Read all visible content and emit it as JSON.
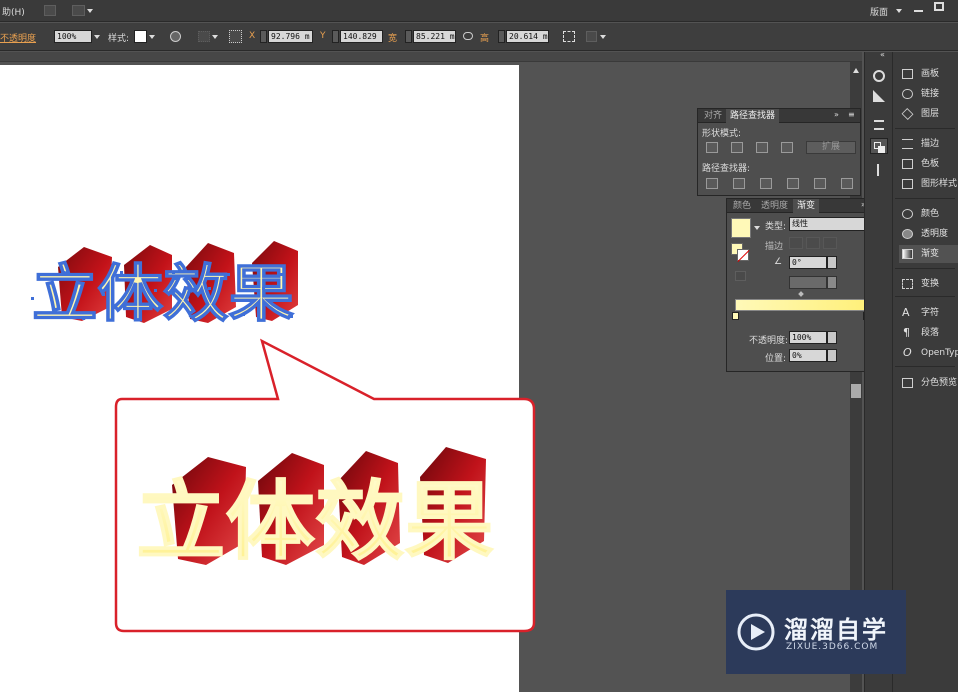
{
  "menu": {
    "help_label": "助(H)",
    "workspace_label": "版面"
  },
  "controlbar": {
    "opacity_label": "不透明度",
    "opacity_value": "100%",
    "style_label": "样式:",
    "x_label": "X",
    "x_value": "92.796 m",
    "y_label": "Y",
    "y_value": "140.829",
    "w_label": "宽",
    "w_value": "85.221 m",
    "h_label": "高",
    "h_value": "20.614 m"
  },
  "artwork": {
    "small_text": "立体效果",
    "large_text": "立体效果",
    "face_color": "#fff6b0",
    "extrude_color": "#b00e14",
    "callout_border_color": "#d9212a"
  },
  "pathfinder_panel": {
    "tabs": [
      "对齐",
      "路径查找器"
    ],
    "shape_modes_label": "形状模式:",
    "expand_label": "扩展",
    "pathfinders_label": "路径查找器:"
  },
  "gradient_panel": {
    "tabs": [
      "颜色",
      "透明度",
      "渐变"
    ],
    "type_label": "类型:",
    "type_value": "线性",
    "stroke_label": "描边",
    "angle_value": "0°",
    "opacity_label": "不透明度:",
    "opacity_value": "100%",
    "location_label": "位置:",
    "location_value": "0%",
    "ramp_start": "#fff9b8",
    "ramp_end": "#fff07a"
  },
  "right_panel": {
    "items": [
      {
        "label": "画板",
        "icon": "artboards-icon"
      },
      {
        "label": "链接",
        "icon": "links-icon"
      },
      {
        "label": "图层",
        "icon": "layers-icon"
      },
      {
        "label": "描边",
        "icon": "stroke-icon"
      },
      {
        "label": "色板",
        "icon": "swatches-icon"
      },
      {
        "label": "图形样式",
        "icon": "graphic-styles-icon"
      },
      {
        "label": "颜色",
        "icon": "color-icon"
      },
      {
        "label": "透明度",
        "icon": "transparency-icon"
      },
      {
        "label": "渐变",
        "icon": "gradient-icon"
      },
      {
        "label": "变换",
        "icon": "transform-icon"
      },
      {
        "label": "字符",
        "icon": "character-icon"
      },
      {
        "label": "段落",
        "icon": "paragraph-icon"
      },
      {
        "label": "OpenTyp",
        "icon": "opentype-icon"
      },
      {
        "label": "分色预览",
        "icon": "separations-icon"
      }
    ]
  },
  "watermark": {
    "name": "溜溜自学",
    "url": "ZIXUE.3D66.COM"
  }
}
